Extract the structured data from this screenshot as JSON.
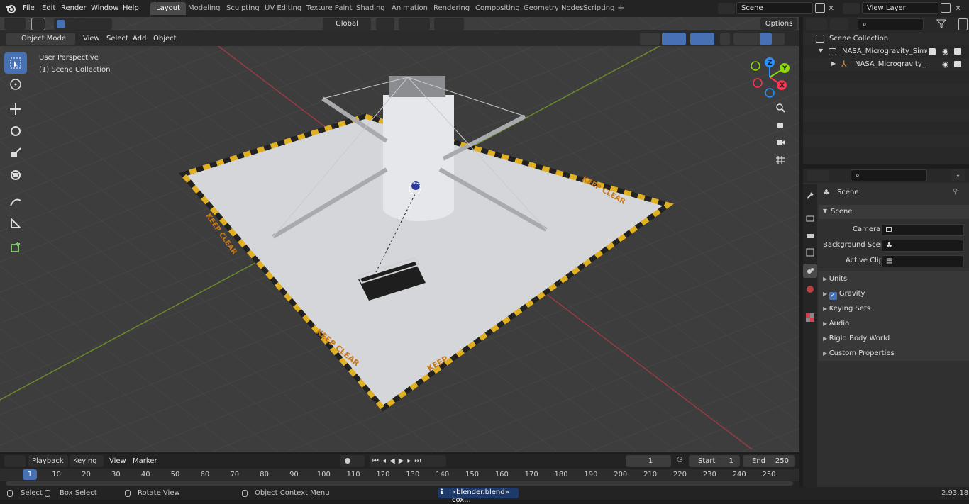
{
  "topbar": {
    "menus": [
      "File",
      "Edit",
      "Render",
      "Window",
      "Help"
    ],
    "workspaces": [
      "Layout",
      "Modeling",
      "Sculpting",
      "UV Editing",
      "Texture Paint",
      "Shading",
      "Animation",
      "Rendering",
      "Compositing",
      "Geometry Nodes",
      "Scripting"
    ],
    "active_workspace": "Layout",
    "scene_name": "Scene",
    "view_layer": "View Layer"
  },
  "viewport_header": {
    "mode": "Object Mode",
    "menus": [
      "View",
      "Select",
      "Add",
      "Object"
    ],
    "transform_orientation": "Global",
    "options": "Options"
  },
  "viewport": {
    "perspective": "User Perspective",
    "collection": "(1) Scene Collection",
    "gizmo_axes": [
      "X",
      "Y",
      "Z"
    ],
    "decals": [
      "KEEP CLEAR",
      "KEEP CLEAR",
      "KEEP CLEAR",
      "KEEP"
    ]
  },
  "outliner": {
    "root": "Scene Collection",
    "items": [
      "NASA_Microgravity_Simulator",
      "NASA_Microgravity_Simu"
    ]
  },
  "properties": {
    "title": "Scene",
    "section": "Scene",
    "fields": [
      {
        "label": "Camera",
        "value": ""
      },
      {
        "label": "Background Scene",
        "value": ""
      },
      {
        "label": "Active Clip",
        "value": ""
      }
    ],
    "panels": [
      "Units",
      "Gravity",
      "Keying Sets",
      "Audio",
      "Rigid Body World",
      "Custom Properties"
    ],
    "gravity_checked": true
  },
  "timeline": {
    "menus": [
      "Playback",
      "Keying",
      "View",
      "Marker"
    ],
    "current_frame": "1",
    "start_label": "Start",
    "start": "1",
    "end_label": "End",
    "end": "250",
    "ticks": [
      "1",
      "10",
      "20",
      "30",
      "40",
      "50",
      "60",
      "70",
      "80",
      "90",
      "100",
      "110",
      "120",
      "130",
      "140",
      "150",
      "160",
      "170",
      "180",
      "190",
      "200",
      "210",
      "220",
      "230",
      "240",
      "250"
    ]
  },
  "statusbar": {
    "select": "Select",
    "box_select": "Box Select",
    "rotate": "Rotate View",
    "context": "Object Context Menu",
    "file": "«blender.blend» cox...",
    "version": "2.93.18"
  },
  "colors": {
    "accent": "#4771b3",
    "x_axis": "#ff3352",
    "y_axis": "#8bdc00",
    "z_axis": "#2890ff"
  }
}
